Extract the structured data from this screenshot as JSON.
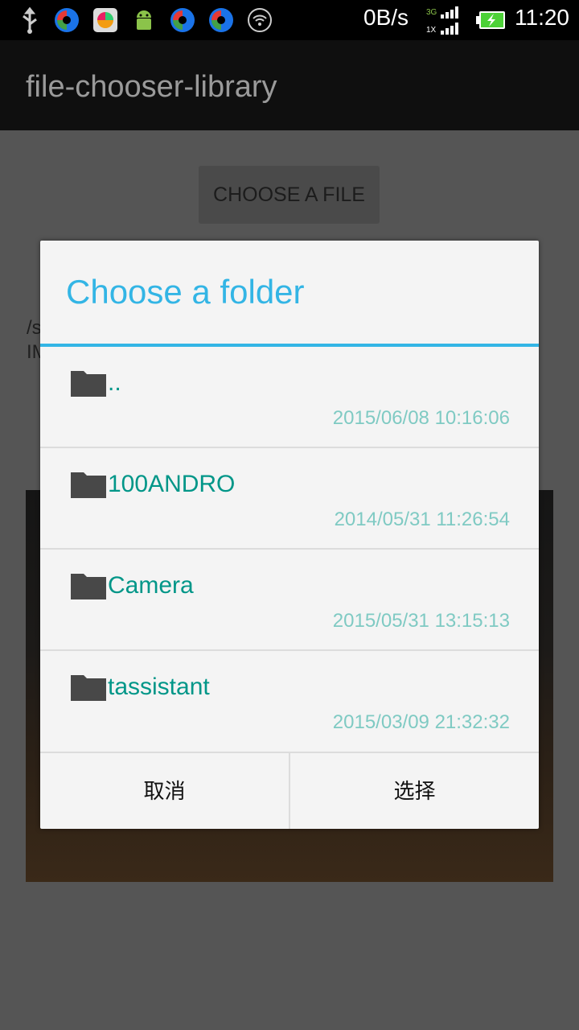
{
  "status_bar": {
    "network_speed": "0B/s",
    "network_type_top": "3G",
    "network_type_bottom": "1X",
    "time": "11:20",
    "icons": [
      "usb-icon",
      "app-icon",
      "app-store-icon",
      "android-debug-icon",
      "app-icon",
      "app-icon",
      "wifi-icon",
      "signal-icon",
      "battery-charging-icon"
    ]
  },
  "action_bar": {
    "title": "file-chooser-library"
  },
  "main": {
    "choose_button_label": "CHOOSE A FILE",
    "path_line1": "/s",
    "path_line2": "IM"
  },
  "dialog": {
    "title": "Choose a folder",
    "items": [
      {
        "name": "..",
        "date": "2015/06/08 10:16:06"
      },
      {
        "name": "100ANDRO",
        "date": "2014/05/31 11:26:54"
      },
      {
        "name": "Camera",
        "date": "2015/05/31 13:15:13"
      },
      {
        "name": "tassistant",
        "date": "2015/03/09 21:32:32"
      }
    ],
    "cancel_label": "取消",
    "select_label": "选择"
  },
  "colors": {
    "accent": "#33b5e5",
    "item_name": "#009688",
    "item_date": "#7fcac3"
  }
}
